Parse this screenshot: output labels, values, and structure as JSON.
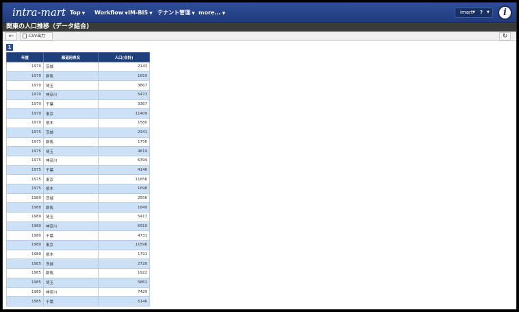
{
  "app": {
    "logo_text": "intra-mart",
    "brand_mark": "i"
  },
  "nav": {
    "items": [
      {
        "label": "Top"
      },
      {
        "label": "Workflow"
      },
      {
        "label": "IM-BIS"
      },
      {
        "label": "テナント管理"
      },
      {
        "label": "more..."
      }
    ],
    "caret": "▼",
    "user": "imart",
    "help": "?"
  },
  "page": {
    "title": "関東の人口推移（データ結合)"
  },
  "toolbar": {
    "back_icon": "←",
    "csv_label": "CSV出力",
    "refresh_icon": "↻"
  },
  "pagination": {
    "current_page": "1"
  },
  "table": {
    "headers": [
      "年度",
      "都道府県名",
      "人口(合計)"
    ],
    "rows": [
      [
        "1970",
        "茨城",
        "2143"
      ],
      [
        "1970",
        "群馬",
        "1659"
      ],
      [
        "1970",
        "埼玉",
        "3867"
      ],
      [
        "1970",
        "神奈川",
        "5473"
      ],
      [
        "1970",
        "千葉",
        "3367"
      ],
      [
        "1970",
        "東京",
        "11409"
      ],
      [
        "1970",
        "栃木",
        "1580"
      ],
      [
        "1975",
        "茨城",
        "2341"
      ],
      [
        "1975",
        "群馬",
        "1756"
      ],
      [
        "1975",
        "埼玉",
        "4819"
      ],
      [
        "1975",
        "神奈川",
        "6394"
      ],
      [
        "1975",
        "千葉",
        "4146"
      ],
      [
        "1975",
        "東京",
        "11656"
      ],
      [
        "1975",
        "栃木",
        "1698"
      ],
      [
        "1980",
        "茨城",
        "2556"
      ],
      [
        "1980",
        "群馬",
        "1849"
      ],
      [
        "1980",
        "埼玉",
        "5417"
      ],
      [
        "1980",
        "神奈川",
        "6919"
      ],
      [
        "1980",
        "千葉",
        "4731"
      ],
      [
        "1980",
        "東京",
        "11598"
      ],
      [
        "1980",
        "栃木",
        "1791"
      ],
      [
        "1985",
        "茨城",
        "2726"
      ],
      [
        "1985",
        "群馬",
        "1922"
      ],
      [
        "1985",
        "埼玉",
        "5861"
      ],
      [
        "1985",
        "神奈川",
        "7429"
      ],
      [
        "1985",
        "千葉",
        "5146"
      ]
    ]
  }
}
